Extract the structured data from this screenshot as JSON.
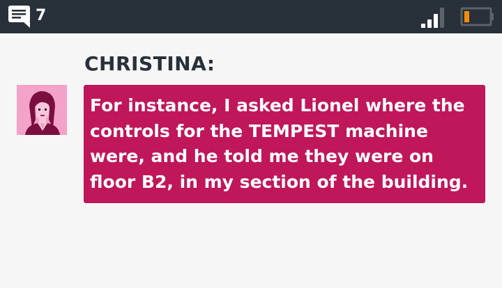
{
  "status_bar": {
    "message_count": "7",
    "icons": [
      "message-icon",
      "signal-icon",
      "battery-icon"
    ],
    "battery_level": 0.2,
    "signal_bars": 3,
    "signal_bars_total": 4
  },
  "conversation": {
    "speaker": "CHRISTINA:",
    "avatar_icon": "christina-portrait-icon",
    "message": "For instance, I asked Lionel where the controls for the TEMPEST machine were, and he told me they were on floor B2, in my section of the building."
  },
  "colors": {
    "status_bar_bg": "#28303a",
    "page_bg": "#f6f6f6",
    "bubble_bg": "#c0165a",
    "avatar_bg": "#f3a2c8",
    "battery_accent": "#f48c0c",
    "speaker_text": "#28303a",
    "bubble_text": "#ffffff"
  }
}
